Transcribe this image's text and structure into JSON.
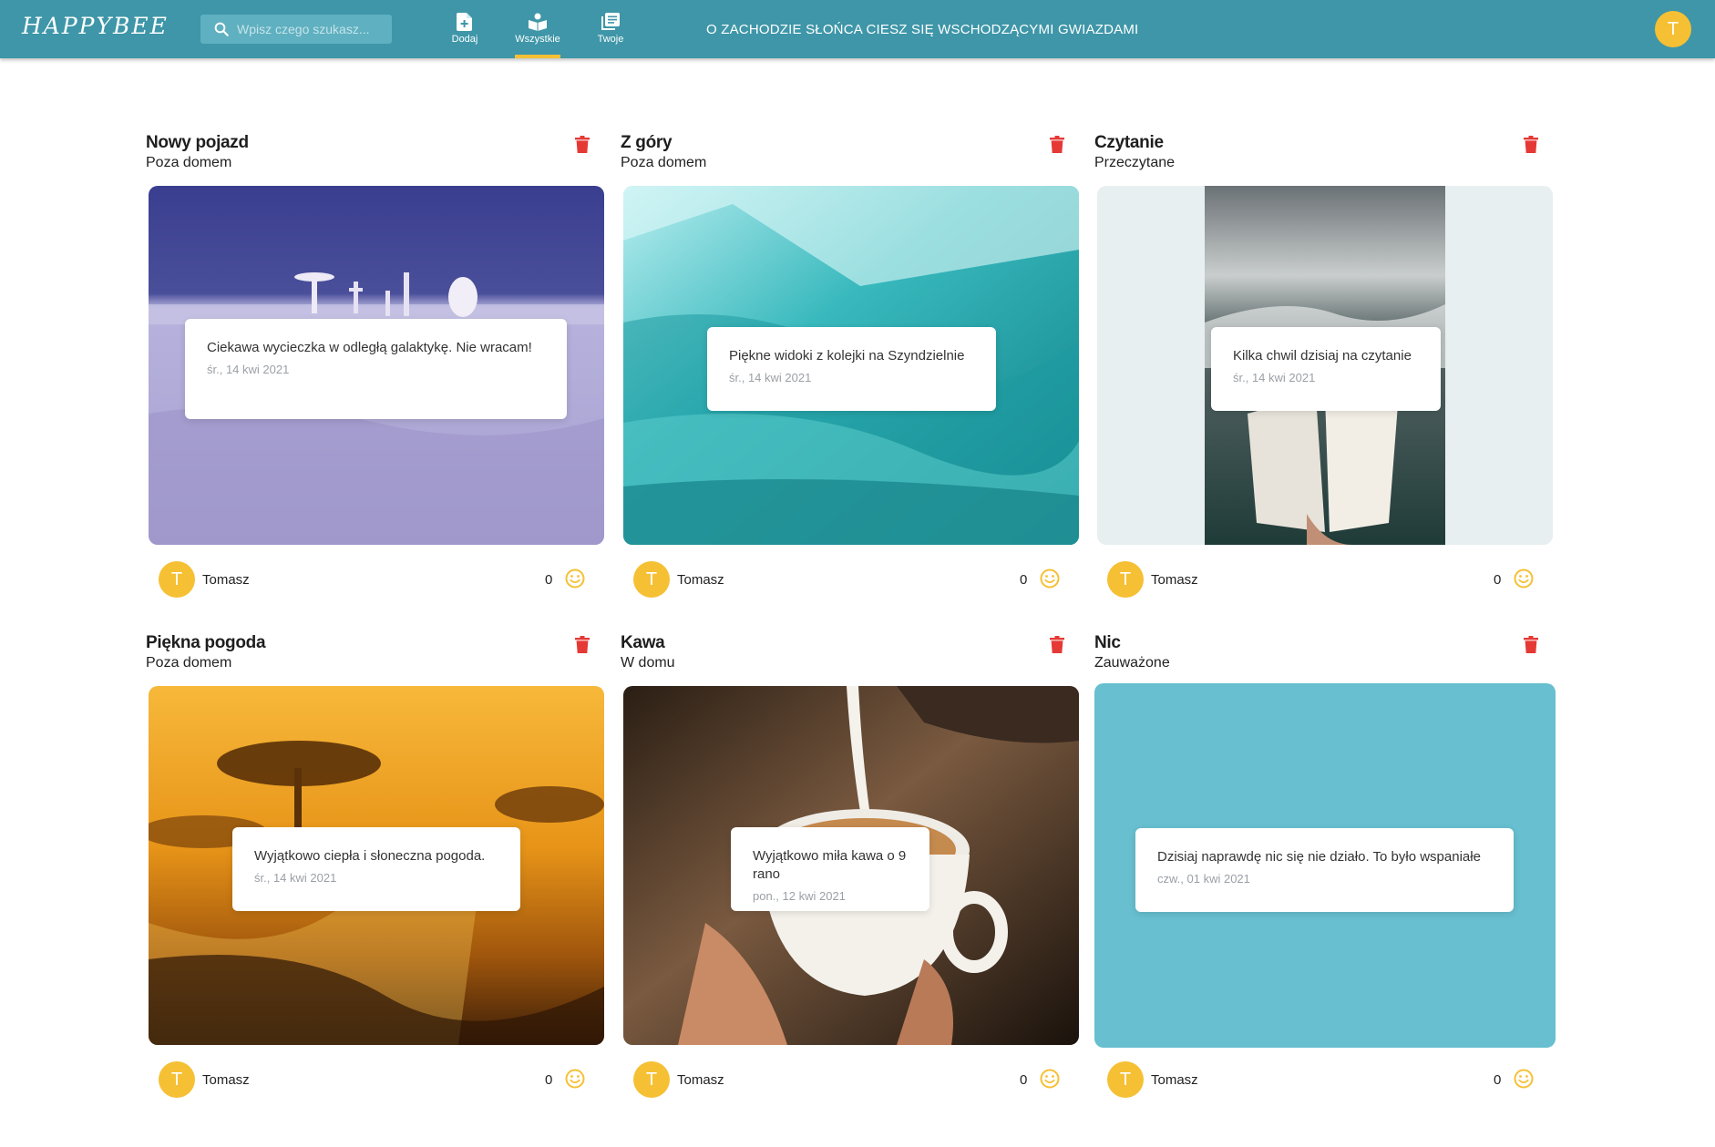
{
  "header": {
    "logo": "HAPPYBEE",
    "search_placeholder": "Wpisz czego szukasz...",
    "nav": [
      {
        "label": "Dodaj",
        "icon": "add-file-icon"
      },
      {
        "label": "Wszystkie",
        "icon": "open-book-icon",
        "active": true
      },
      {
        "label": "Twoje",
        "icon": "list-icon"
      }
    ],
    "motto": "O ZACHODZIE SŁOŃCA CIESZ SIĘ WSCHODZĄCYMI GWIAZDAMI",
    "user_initial": "T"
  },
  "colors": {
    "topbar": "#3e96a8",
    "accent": "#f6c034",
    "delete": "#e53935",
    "plain_card": "#67bfcf"
  },
  "cards": [
    {
      "title": "Nowy pojazd",
      "category": "Poza domem",
      "caption": "Ciekawa wycieczka w odległą galaktykę. Nie wracam!",
      "date": "śr., 14 kwi 2021",
      "author": "Tomasz",
      "author_initial": "T",
      "likes": "0",
      "image": "lavender landscape with astronaut"
    },
    {
      "title": "Z góry",
      "category": "Poza domem",
      "caption": "Piękne widoki z kolejki na Szyndzielnie",
      "date": "śr., 14 kwi 2021",
      "author": "Tomasz",
      "author_initial": "T",
      "likes": "0",
      "image": "turquoise forest valley"
    },
    {
      "title": "Czytanie",
      "category": "Przeczytane",
      "caption": "Kilka chwil dzisiaj na czytanie",
      "date": "śr., 14 kwi 2021",
      "author": "Tomasz",
      "author_initial": "T",
      "likes": "0",
      "image": "open book against misty mountains"
    },
    {
      "title": "Piękna pogoda",
      "category": "Poza domem",
      "caption": "Wyjątkowo ciepła i słoneczna pogoda.",
      "date": "śr., 14 kwi 2021",
      "author": "Tomasz",
      "author_initial": "T",
      "likes": "0",
      "image": "golden savanna sunset with acacia trees"
    },
    {
      "title": "Kawa",
      "category": "W domu",
      "caption": "Wyjątkowo miła kawa o 9 rano",
      "date": "pon., 12 kwi 2021",
      "author": "Tomasz",
      "author_initial": "T",
      "likes": "0",
      "image": "milk poured into coffee cup"
    },
    {
      "title": "Nic",
      "category": "Zauważone",
      "caption": "Dzisiaj naprawdę nic się nie działo. To było wspaniałe",
      "date": "czw., 01 kwi 2021",
      "author": "Tomasz",
      "author_initial": "T",
      "likes": "0",
      "image": ""
    }
  ]
}
